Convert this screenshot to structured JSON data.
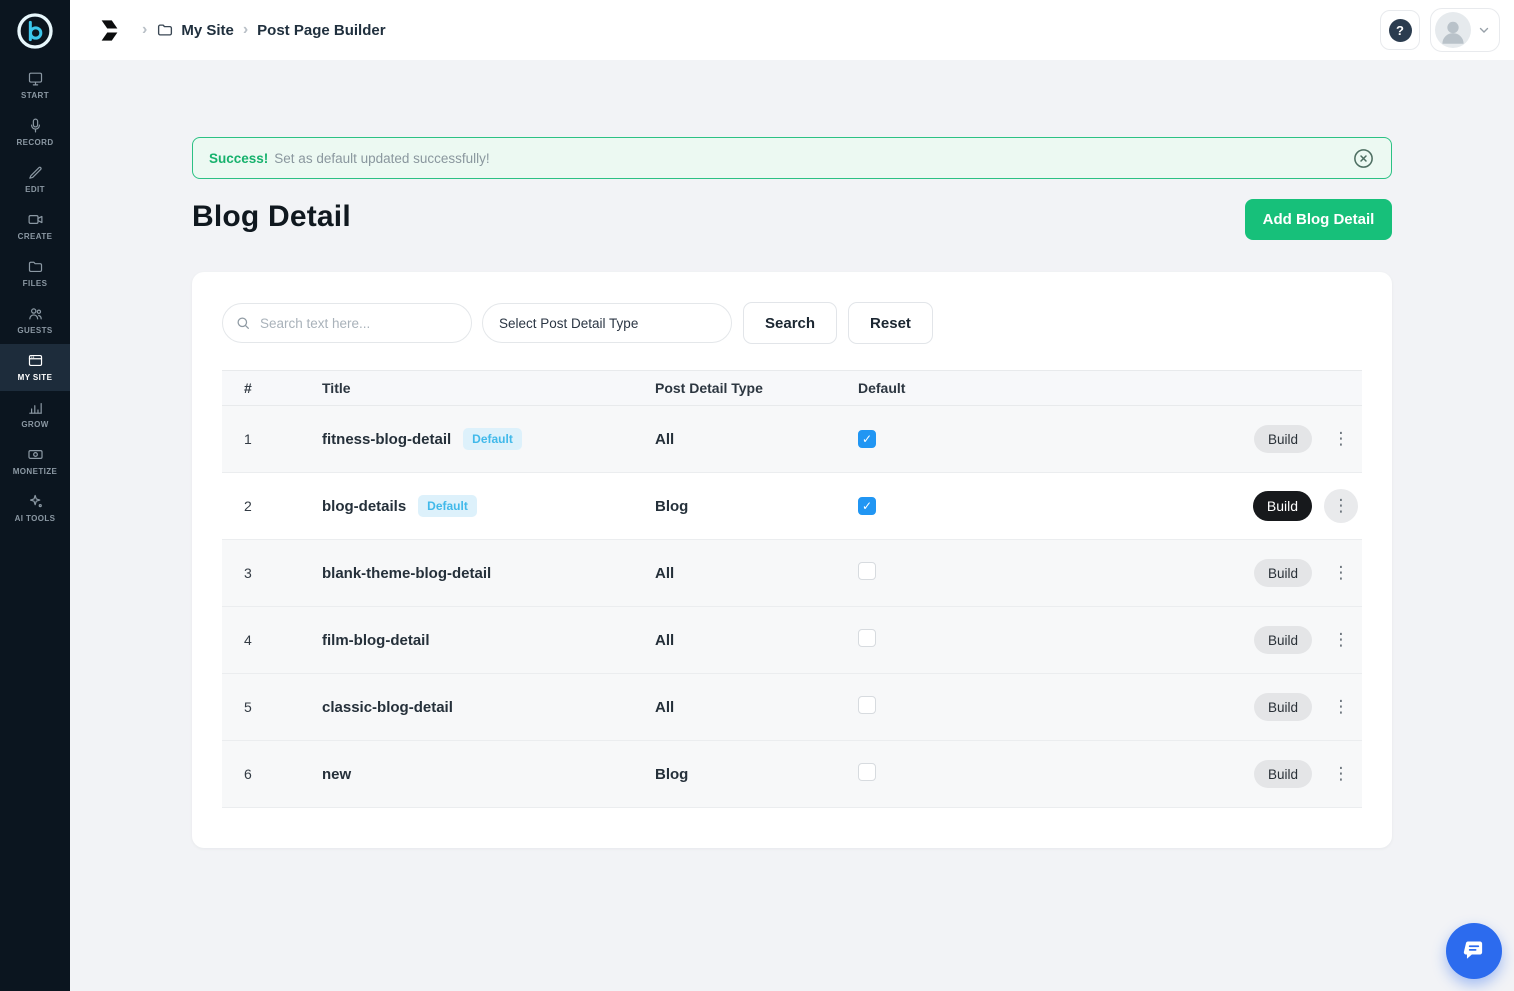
{
  "sidebar": {
    "items": [
      {
        "id": "start",
        "label": "START",
        "icon": "start-icon",
        "active": false
      },
      {
        "id": "record",
        "label": "RECORD",
        "icon": "record-icon",
        "active": false
      },
      {
        "id": "edit",
        "label": "EDIT",
        "icon": "edit-icon",
        "active": false
      },
      {
        "id": "create",
        "label": "CREATE",
        "icon": "create-icon",
        "active": false
      },
      {
        "id": "files",
        "label": "FILES",
        "icon": "files-icon",
        "active": false
      },
      {
        "id": "guests",
        "label": "GUESTS",
        "icon": "guests-icon",
        "active": false
      },
      {
        "id": "my-site",
        "label": "MY SITE",
        "icon": "my-site-icon",
        "active": true
      },
      {
        "id": "grow",
        "label": "GROW",
        "icon": "grow-icon",
        "active": false
      },
      {
        "id": "monetize",
        "label": "MONETIZE",
        "icon": "monetize-icon",
        "active": false
      },
      {
        "id": "ai-tools",
        "label": "AI TOOLS",
        "icon": "ai-tools-icon",
        "active": false
      }
    ]
  },
  "topbar": {
    "breadcrumb_site": "My Site",
    "breadcrumb_page": "Post Page Builder",
    "help_label": "?"
  },
  "alert": {
    "title": "Success!",
    "message": "Set as default updated successfully!"
  },
  "page": {
    "title": "Blog Detail",
    "add_button_label": "Add Blog Detail"
  },
  "filters": {
    "search_placeholder": "Search text here...",
    "select_value": "Select Post Detail Type",
    "search_button_label": "Search",
    "reset_button_label": "Reset"
  },
  "table": {
    "headers": [
      "#",
      "Title",
      "Post Detail Type",
      "Default"
    ],
    "build_label": "Build",
    "rows": [
      {
        "num": "1",
        "title": "fitness-blog-detail",
        "badge": "Default",
        "type": "All",
        "checked": true,
        "active": false
      },
      {
        "num": "2",
        "title": "blog-details",
        "badge": "Default",
        "type": "Blog",
        "checked": true,
        "active": true
      },
      {
        "num": "3",
        "title": "blank-theme-blog-detail",
        "badge": null,
        "type": "All",
        "checked": false,
        "active": false
      },
      {
        "num": "4",
        "title": "film-blog-detail",
        "badge": null,
        "type": "All",
        "checked": false,
        "active": false
      },
      {
        "num": "5",
        "title": "classic-blog-detail",
        "badge": null,
        "type": "All",
        "checked": false,
        "active": false
      },
      {
        "num": "6",
        "title": "new",
        "badge": null,
        "type": "Blog",
        "checked": false,
        "active": false
      }
    ]
  },
  "colors": {
    "sidebar_bg": "#0b151f",
    "accent_green": "#17c07a",
    "success_border": "#2cc184",
    "badge_blue": "#41b9ea",
    "checkbox_blue": "#2196f3",
    "chat_blue": "#2c6bee"
  }
}
